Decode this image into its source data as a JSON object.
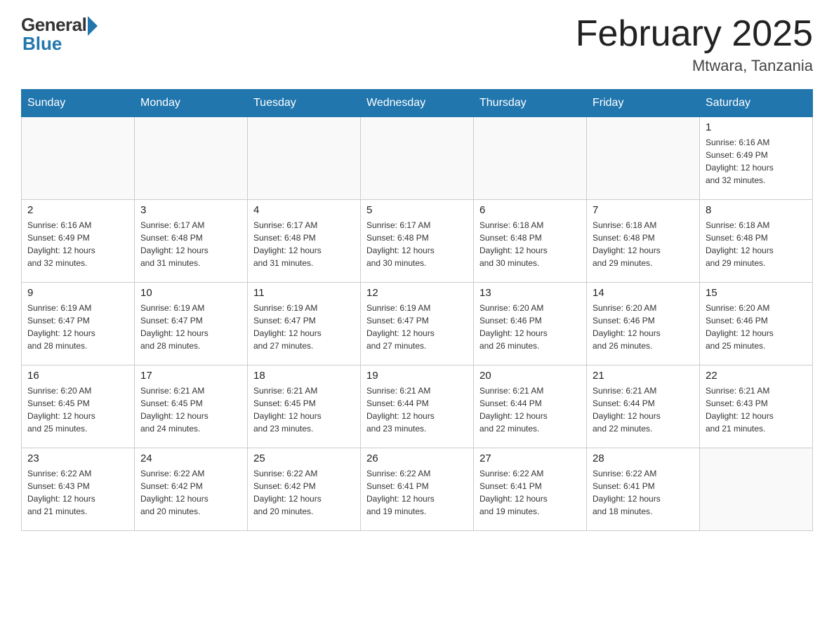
{
  "logo": {
    "general": "General",
    "blue": "Blue"
  },
  "title": "February 2025",
  "location": "Mtwara, Tanzania",
  "weekdays": [
    "Sunday",
    "Monday",
    "Tuesday",
    "Wednesday",
    "Thursday",
    "Friday",
    "Saturday"
  ],
  "weeks": [
    [
      {
        "day": "",
        "info": ""
      },
      {
        "day": "",
        "info": ""
      },
      {
        "day": "",
        "info": ""
      },
      {
        "day": "",
        "info": ""
      },
      {
        "day": "",
        "info": ""
      },
      {
        "day": "",
        "info": ""
      },
      {
        "day": "1",
        "info": "Sunrise: 6:16 AM\nSunset: 6:49 PM\nDaylight: 12 hours\nand 32 minutes."
      }
    ],
    [
      {
        "day": "2",
        "info": "Sunrise: 6:16 AM\nSunset: 6:49 PM\nDaylight: 12 hours\nand 32 minutes."
      },
      {
        "day": "3",
        "info": "Sunrise: 6:17 AM\nSunset: 6:48 PM\nDaylight: 12 hours\nand 31 minutes."
      },
      {
        "day": "4",
        "info": "Sunrise: 6:17 AM\nSunset: 6:48 PM\nDaylight: 12 hours\nand 31 minutes."
      },
      {
        "day": "5",
        "info": "Sunrise: 6:17 AM\nSunset: 6:48 PM\nDaylight: 12 hours\nand 30 minutes."
      },
      {
        "day": "6",
        "info": "Sunrise: 6:18 AM\nSunset: 6:48 PM\nDaylight: 12 hours\nand 30 minutes."
      },
      {
        "day": "7",
        "info": "Sunrise: 6:18 AM\nSunset: 6:48 PM\nDaylight: 12 hours\nand 29 minutes."
      },
      {
        "day": "8",
        "info": "Sunrise: 6:18 AM\nSunset: 6:48 PM\nDaylight: 12 hours\nand 29 minutes."
      }
    ],
    [
      {
        "day": "9",
        "info": "Sunrise: 6:19 AM\nSunset: 6:47 PM\nDaylight: 12 hours\nand 28 minutes."
      },
      {
        "day": "10",
        "info": "Sunrise: 6:19 AM\nSunset: 6:47 PM\nDaylight: 12 hours\nand 28 minutes."
      },
      {
        "day": "11",
        "info": "Sunrise: 6:19 AM\nSunset: 6:47 PM\nDaylight: 12 hours\nand 27 minutes."
      },
      {
        "day": "12",
        "info": "Sunrise: 6:19 AM\nSunset: 6:47 PM\nDaylight: 12 hours\nand 27 minutes."
      },
      {
        "day": "13",
        "info": "Sunrise: 6:20 AM\nSunset: 6:46 PM\nDaylight: 12 hours\nand 26 minutes."
      },
      {
        "day": "14",
        "info": "Sunrise: 6:20 AM\nSunset: 6:46 PM\nDaylight: 12 hours\nand 26 minutes."
      },
      {
        "day": "15",
        "info": "Sunrise: 6:20 AM\nSunset: 6:46 PM\nDaylight: 12 hours\nand 25 minutes."
      }
    ],
    [
      {
        "day": "16",
        "info": "Sunrise: 6:20 AM\nSunset: 6:45 PM\nDaylight: 12 hours\nand 25 minutes."
      },
      {
        "day": "17",
        "info": "Sunrise: 6:21 AM\nSunset: 6:45 PM\nDaylight: 12 hours\nand 24 minutes."
      },
      {
        "day": "18",
        "info": "Sunrise: 6:21 AM\nSunset: 6:45 PM\nDaylight: 12 hours\nand 23 minutes."
      },
      {
        "day": "19",
        "info": "Sunrise: 6:21 AM\nSunset: 6:44 PM\nDaylight: 12 hours\nand 23 minutes."
      },
      {
        "day": "20",
        "info": "Sunrise: 6:21 AM\nSunset: 6:44 PM\nDaylight: 12 hours\nand 22 minutes."
      },
      {
        "day": "21",
        "info": "Sunrise: 6:21 AM\nSunset: 6:44 PM\nDaylight: 12 hours\nand 22 minutes."
      },
      {
        "day": "22",
        "info": "Sunrise: 6:21 AM\nSunset: 6:43 PM\nDaylight: 12 hours\nand 21 minutes."
      }
    ],
    [
      {
        "day": "23",
        "info": "Sunrise: 6:22 AM\nSunset: 6:43 PM\nDaylight: 12 hours\nand 21 minutes."
      },
      {
        "day": "24",
        "info": "Sunrise: 6:22 AM\nSunset: 6:42 PM\nDaylight: 12 hours\nand 20 minutes."
      },
      {
        "day": "25",
        "info": "Sunrise: 6:22 AM\nSunset: 6:42 PM\nDaylight: 12 hours\nand 20 minutes."
      },
      {
        "day": "26",
        "info": "Sunrise: 6:22 AM\nSunset: 6:41 PM\nDaylight: 12 hours\nand 19 minutes."
      },
      {
        "day": "27",
        "info": "Sunrise: 6:22 AM\nSunset: 6:41 PM\nDaylight: 12 hours\nand 19 minutes."
      },
      {
        "day": "28",
        "info": "Sunrise: 6:22 AM\nSunset: 6:41 PM\nDaylight: 12 hours\nand 18 minutes."
      },
      {
        "day": "",
        "info": ""
      }
    ]
  ]
}
